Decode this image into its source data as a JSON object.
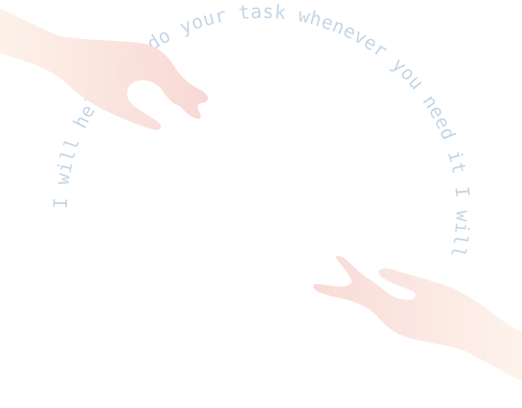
{
  "ring": {
    "text_top": "I will help you do your task whenever you need it I will",
    "text_bottom": "help you do your task whenever you need it I will",
    "color": "#c4d6e6"
  },
  "hands": {
    "top_left": {
      "icon": "reaching-hand-icon",
      "color_from": "#fdf1e8",
      "color_to": "#f8d9d6"
    },
    "bottom_right": {
      "icon": "reaching-hand-icon",
      "color_from": "#f8dcd8",
      "color_to": "#fdf1e8"
    }
  }
}
